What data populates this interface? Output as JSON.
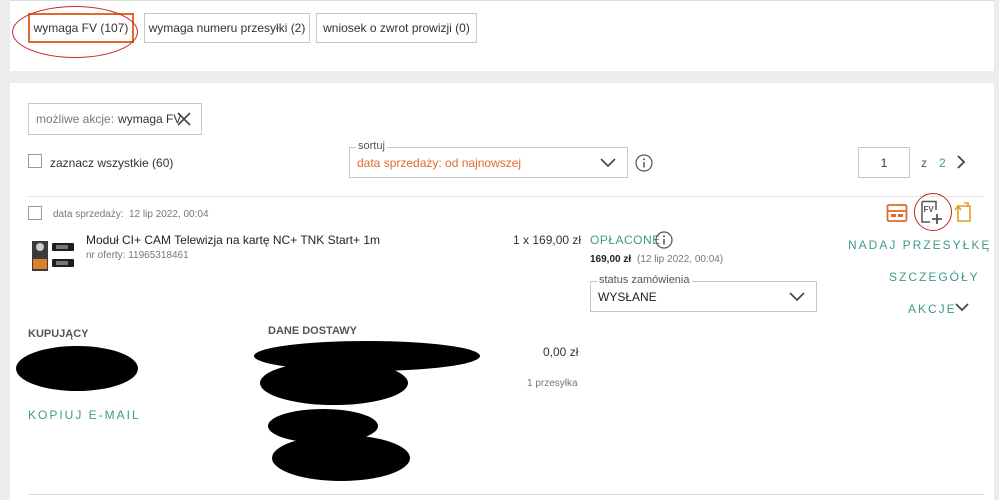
{
  "filters": {
    "requires_invoice": "wymaga FV (107)",
    "requires_tracking": "wymaga numeru przesyłki (2)",
    "commission_refund": "wniosek o zwrot prowizji (0)"
  },
  "actions_chip": {
    "label": "możliwe akcje:",
    "value": "wymaga FV"
  },
  "select_all": {
    "label": "zaznacz wszystkie (60)"
  },
  "sort": {
    "caption": "sortuj",
    "value": "data sprzedaży: od najnowszej"
  },
  "pagination": {
    "current": "1",
    "of_label": "z",
    "total": "2"
  },
  "order": {
    "sale_date_label": "data sprzedaży:",
    "sale_date": "12 lip 2022, 00:04",
    "product_title": "Moduł CI+ CAM Telewizja na kartę NC+ TNK Start+ 1m",
    "offer_number": "nr oferty: 11965318461",
    "quantity_price": "1 x 169,00 zł",
    "payment_status": "OPŁACONE",
    "paid_amount": "169,00 zł",
    "paid_date": "(12 lip 2022, 00:04)",
    "order_status_caption": "status zamówienia",
    "order_status_value": "WYSŁANE",
    "send_shipment": "NADAJ PRZESYŁKĘ",
    "details": "SZCZEGÓŁY",
    "actions": "AKCJE",
    "buyer_heading": "KUPUJĄCY",
    "delivery_heading": "DANE DOSTAWY",
    "shipping_cost": "0,00 zł",
    "shipments_count": "1 przesyłka",
    "copy_email": "KOPIUJ E-MAIL",
    "invoice_icon_text": "FV"
  },
  "colors": {
    "accent_orange": "#e06a2c",
    "teal": "#3d9a8f",
    "annotation_red": "#c62828"
  }
}
